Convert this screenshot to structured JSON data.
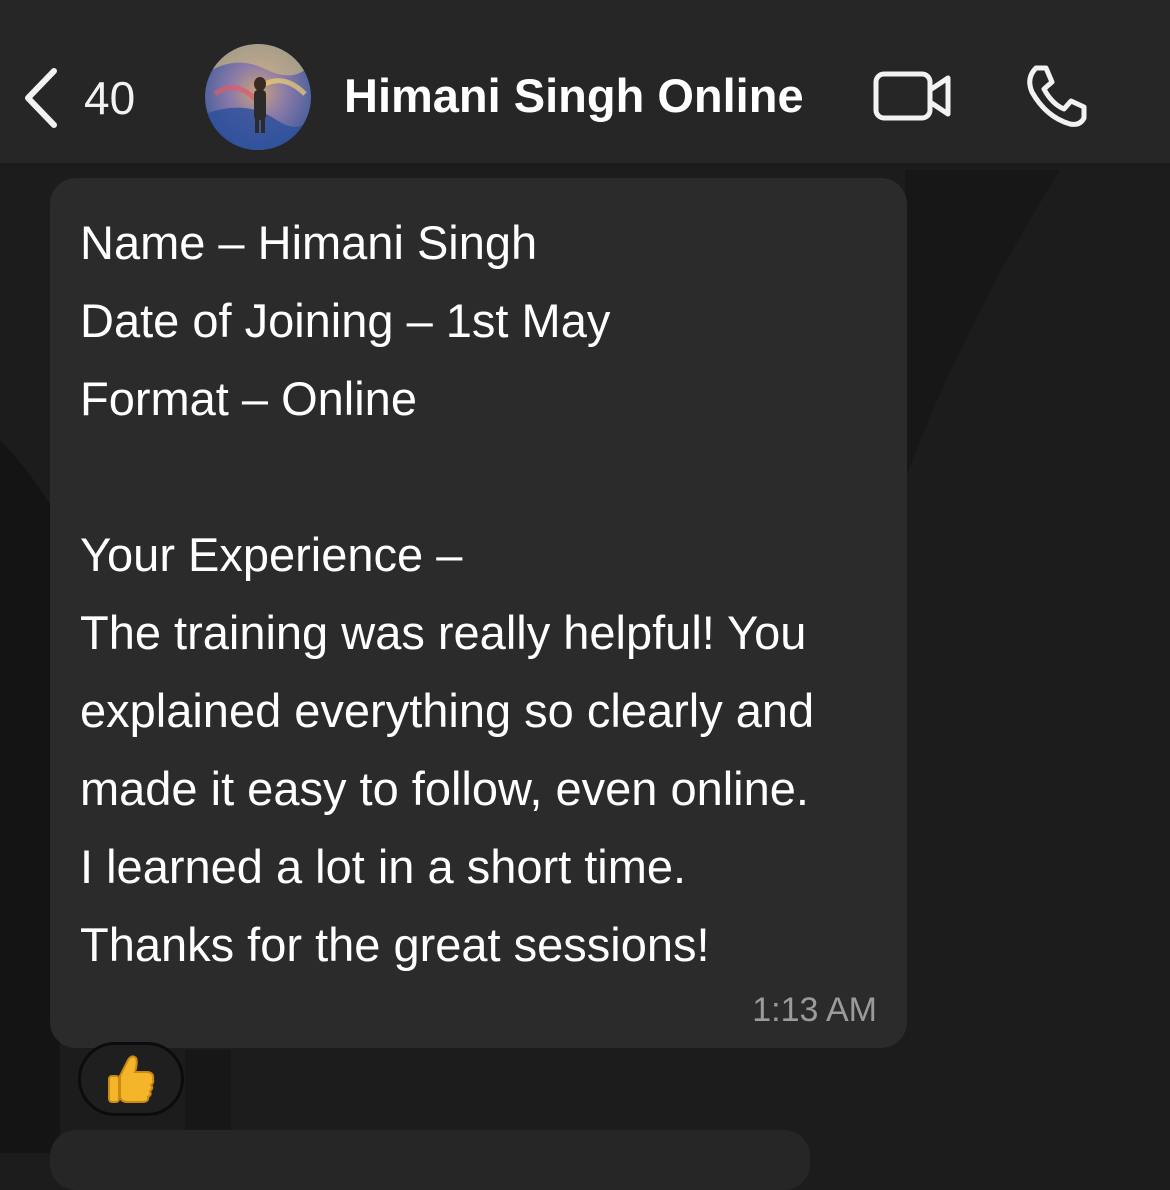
{
  "header": {
    "back_count": "40",
    "contact_name": "Himani Singh Online",
    "icons": [
      "chevron-left-icon",
      "video-camera-icon",
      "phone-icon"
    ]
  },
  "message": {
    "lines": [
      "Name – Himani Singh",
      "Date of Joining – 1st May",
      "Format – Online",
      "",
      "Your Experience –",
      "The training was really helpful! You",
      "explained everything so clearly and",
      "made it easy to follow, even online.",
      "I learned a lot in a short time.",
      "Thanks for the great sessions!"
    ],
    "time": "1:13 AM",
    "reaction": "thumbs-up-icon"
  },
  "colors": {
    "background": "#1c1c1c",
    "header": "#262626",
    "bubble": "#2b2b2c",
    "timestamp": "#9b9b9b",
    "reaction_emoji": "#f5b52a"
  }
}
